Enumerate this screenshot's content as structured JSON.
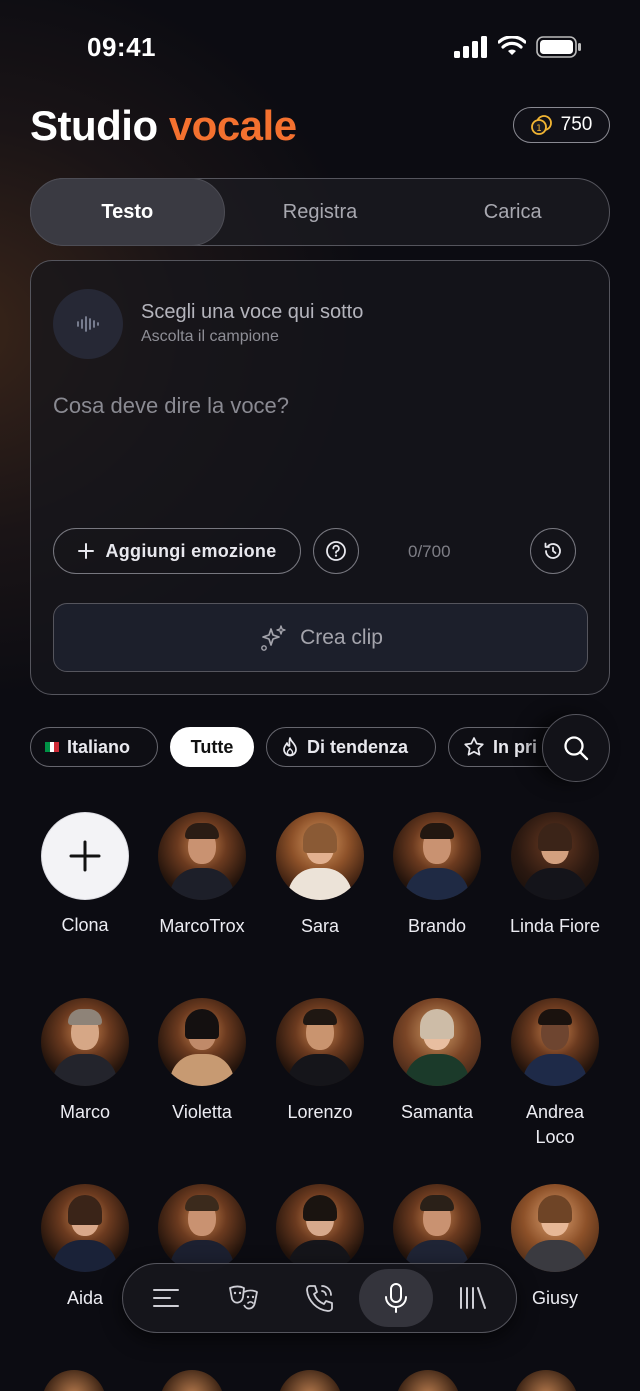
{
  "status": {
    "time": "09:41"
  },
  "header": {
    "title_main": "Studio",
    "title_accent": "vocale",
    "credits": "750"
  },
  "tabs": [
    {
      "label": "Testo"
    },
    {
      "label": "Registra"
    },
    {
      "label": "Carica"
    }
  ],
  "composer": {
    "voice_title": "Scegli una voce qui sotto",
    "voice_subtitle": "Ascolta il campione",
    "input_placeholder": "Cosa deve dire la voce?",
    "input_value": "",
    "add_emotion_label": "Aggiungi emozione",
    "char_count": "0/700",
    "create_label": "Crea clip"
  },
  "filters": {
    "language": "Italiano",
    "all": "Tutte",
    "trending": "Di tendenza",
    "featured": "In pri"
  },
  "voices": [
    {
      "name": "Clona"
    },
    {
      "name": "MarcoTrox"
    },
    {
      "name": "Sara"
    },
    {
      "name": "Brando"
    },
    {
      "name": "Linda Fiore"
    },
    {
      "name": "Marco"
    },
    {
      "name": "Violetta"
    },
    {
      "name": "Lorenzo"
    },
    {
      "name": "Samanta"
    },
    {
      "name": "Andrea Loco"
    },
    {
      "name": "Aida"
    },
    {
      "name": "Giusy"
    }
  ],
  "nav": [
    {
      "icon": "menu-icon"
    },
    {
      "icon": "masks-icon"
    },
    {
      "icon": "phone-call-icon"
    },
    {
      "icon": "microphone-icon"
    },
    {
      "icon": "library-icon"
    }
  ],
  "colors": {
    "accent": "#f4712f",
    "background": "#0c0c12",
    "coin": "#f2b533"
  }
}
